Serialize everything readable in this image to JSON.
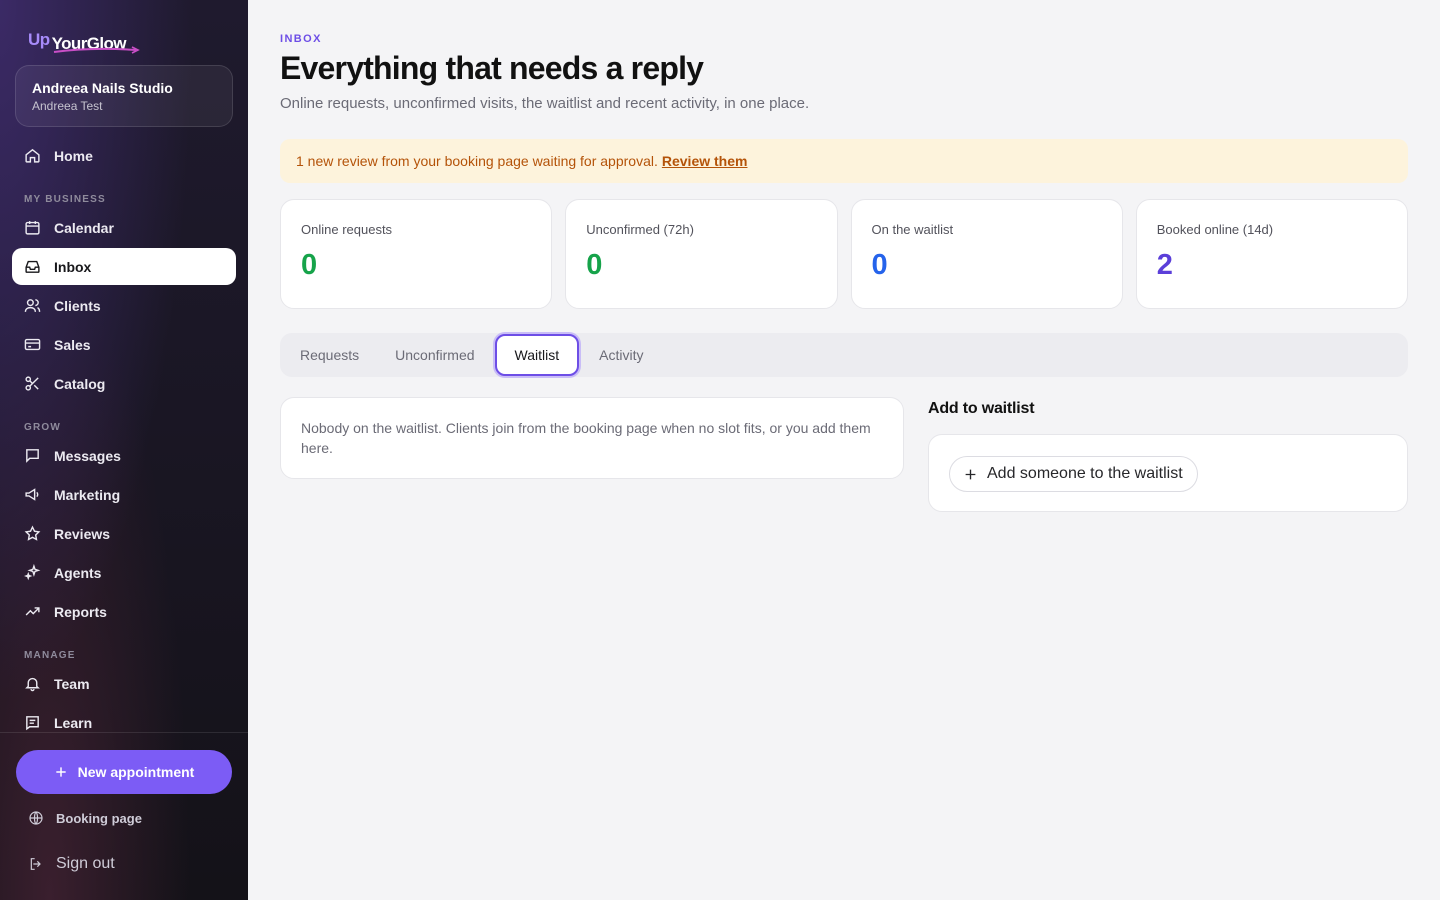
{
  "brand": {
    "logo_prefix": "Up",
    "logo_name": "YourGlow",
    "accent": "#7c5cf5"
  },
  "studio": {
    "name": "Andreea Nails Studio",
    "user": "Andreea Test"
  },
  "nav": {
    "home": "Home",
    "section_business": "MY BUSINESS",
    "calendar": "Calendar",
    "inbox": "Inbox",
    "clients": "Clients",
    "sales": "Sales",
    "catalog": "Catalog",
    "section_grow": "GROW",
    "messages": "Messages",
    "marketing": "Marketing",
    "reviews": "Reviews",
    "agents": "Agents",
    "reports": "Reports",
    "section_manage": "MANAGE",
    "team": "Team",
    "learn": "Learn"
  },
  "footer": {
    "new_appointment": "New appointment",
    "booking_page": "Booking page",
    "sign_out": "Sign out"
  },
  "header": {
    "eyebrow": "INBOX",
    "title": "Everything that needs a reply",
    "subtitle": "Online requests, unconfirmed visits, the waitlist and recent activity, in one place."
  },
  "banner": {
    "text": "1 new review from your booking page waiting for approval.",
    "link": "Review them"
  },
  "stats": [
    {
      "label": "Online requests",
      "value": "0",
      "color": "#16a34a"
    },
    {
      "label": "Unconfirmed (72h)",
      "value": "0",
      "color": "#16a34a"
    },
    {
      "label": "On the waitlist",
      "value": "0",
      "color": "#2563eb"
    },
    {
      "label": "Booked online (14d)",
      "value": "2",
      "color": "#5b3fd9"
    }
  ],
  "tabs": [
    "Requests",
    "Unconfirmed",
    "Waitlist",
    "Activity"
  ],
  "active_tab": "Waitlist",
  "waitlist": {
    "empty_text": "Nobody on the waitlist. Clients join from the booking page when no slot fits, or you add them here.",
    "side_title": "Add to waitlist",
    "add_button": "Add someone to the waitlist"
  }
}
